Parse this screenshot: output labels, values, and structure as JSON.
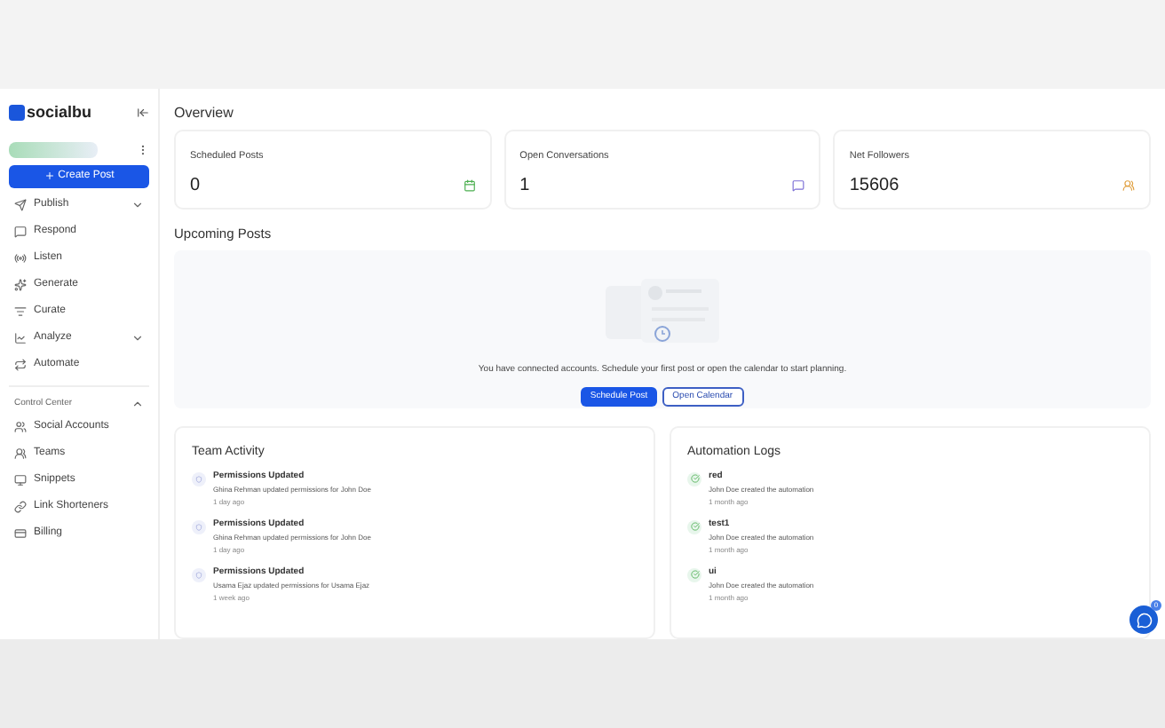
{
  "logo": {
    "text": "socialbu"
  },
  "create_button": {
    "label": "Create Post"
  },
  "sidebar": {
    "items": [
      {
        "label": "Publish",
        "kind": "send",
        "expanded": false
      },
      {
        "label": "Respond",
        "kind": "chat"
      },
      {
        "label": "Listen",
        "kind": "radio"
      },
      {
        "label": "Generate",
        "kind": "sparkle"
      },
      {
        "label": "Curate",
        "kind": "filter"
      },
      {
        "label": "Analyze",
        "kind": "chart",
        "expanded": false
      },
      {
        "label": "Automate",
        "kind": "repeat"
      }
    ],
    "section": {
      "title": "Control Center",
      "expanded": true,
      "items": [
        {
          "label": "Social Accounts",
          "kind": "users"
        },
        {
          "label": "Teams",
          "kind": "team"
        },
        {
          "label": "Snippets",
          "kind": "monitor"
        },
        {
          "label": "Link Shorteners",
          "kind": "link"
        },
        {
          "label": "Billing",
          "kind": "card"
        }
      ]
    }
  },
  "overview": {
    "title": "Overview",
    "cards": [
      {
        "label": "Scheduled Posts",
        "value": "0",
        "kind": "calendar"
      },
      {
        "label": "Open Conversations",
        "value": "1",
        "kind": "chat"
      },
      {
        "label": "Net Followers",
        "value": "15606",
        "kind": "people"
      }
    ]
  },
  "upcoming": {
    "title": "Upcoming Posts",
    "message": "You have connected accounts. Schedule your first post or open the calendar to start planning.",
    "primary": "Schedule Post",
    "secondary": "Open Calendar"
  },
  "team_activity": {
    "title": "Team Activity",
    "items": [
      {
        "title": "Permissions Updated",
        "detail": "Ghina Rehman updated permissions for John Doe",
        "time": "1 day ago"
      },
      {
        "title": "Permissions Updated",
        "detail": "Ghina Rehman updated permissions for John Doe",
        "time": "1 day ago"
      },
      {
        "title": "Permissions Updated",
        "detail": "Usama Ejaz updated permissions for Usama Ejaz",
        "time": "1 week ago"
      }
    ]
  },
  "automation_logs": {
    "title": "Automation Logs",
    "items": [
      {
        "title": "red",
        "detail": "John Doe created the automation",
        "time": "1 month ago"
      },
      {
        "title": "test1",
        "detail": "John Doe created the automation",
        "time": "1 month ago"
      },
      {
        "title": "ui",
        "detail": "John Doe created the automation",
        "time": "1 month ago"
      }
    ]
  },
  "chat_widget": {
    "badge": "0"
  }
}
